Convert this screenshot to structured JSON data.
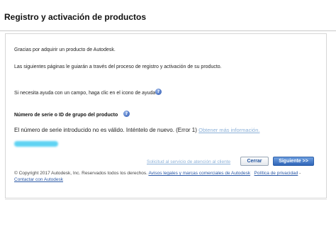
{
  "header": {
    "title": "Registro y activación de productos"
  },
  "intro": {
    "line1": "Gracias por adquirir un producto de Autodesk.",
    "line2": "Las siguientes páginas le guiarán a través del proceso de registro y activación de su producto.",
    "help_line": "Si necesita ayuda con un campo, haga clic en el icono de ayuda"
  },
  "serial": {
    "heading": "Número de serie o ID de grupo del producto",
    "error_text": "El número de serie introducido no es válido. Inténtelo de nuevo. (Error 1)",
    "more_info_link": "Obtener más información."
  },
  "actions": {
    "service_link": "Solicitud al servicio de atención al cliente",
    "close_button": "Cerrar",
    "next_button": "Siguiente >>"
  },
  "footer": {
    "copyright": "© Copyright 2017 Autodesk, Inc. Reservados todos los derechos.",
    "legal_link": "Avisos legales y marcas comerciales de Autodesk",
    "privacy_link": "Política de privacidad",
    "separator": " - ",
    "contact_link": "Contactar con Autodesk"
  },
  "icons": {
    "help": "help-icon"
  },
  "colors": {
    "primary_button": "#2f65b8",
    "link": "#2a58a6",
    "muted_link": "#8bb0d8"
  }
}
